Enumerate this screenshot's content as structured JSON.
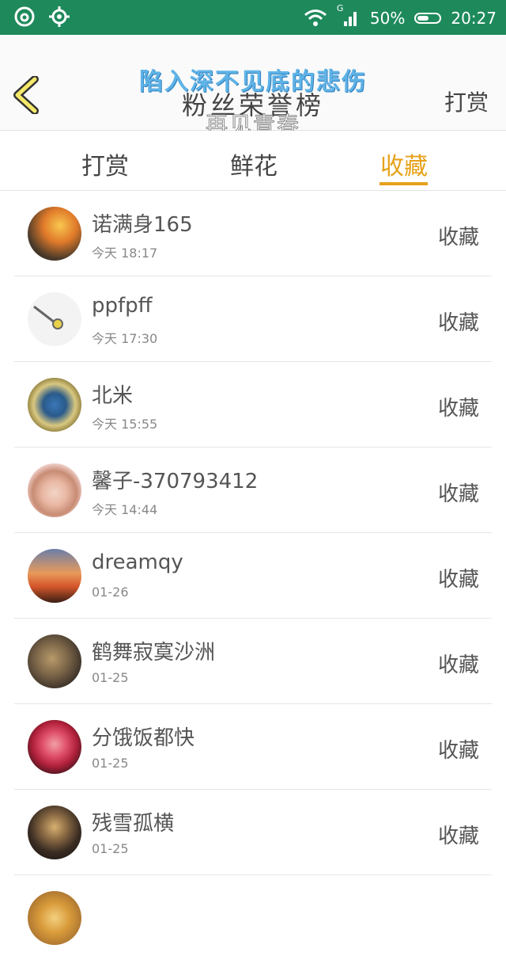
{
  "status_bar": {
    "signal_label": "G",
    "battery_percent": "50%",
    "time": "20:27"
  },
  "header": {
    "title": "粉丝荣誉榜",
    "overlay_top": "陷入深不见底的悲伤",
    "overlay_bottom": "再见青春",
    "action_label": "打赏"
  },
  "tabs": [
    {
      "label": "打赏",
      "active": false
    },
    {
      "label": "鲜花",
      "active": false
    },
    {
      "label": "收藏",
      "active": true
    }
  ],
  "list": [
    {
      "name": "诺满身165",
      "time": "今天 18:17",
      "action": "收藏"
    },
    {
      "name": "ppfpff",
      "time": "今天 17:30",
      "action": "收藏"
    },
    {
      "name": "北米",
      "time": "今天 15:55",
      "action": "收藏"
    },
    {
      "name": "馨子-370793412",
      "time": "今天 14:44",
      "action": "收藏"
    },
    {
      "name": "dreamqy",
      "time": "01-26",
      "action": "收藏"
    },
    {
      "name": "鹤舞寂寞沙洲",
      "time": "01-25",
      "action": "收藏"
    },
    {
      "name": "分饿饭都快",
      "time": "01-25",
      "action": "收藏"
    },
    {
      "name": "残雪孤横",
      "time": "01-25",
      "action": "收藏"
    }
  ],
  "colors": {
    "status_bar": "#1e8a5c",
    "accent": "#e6a21b",
    "back_arrow_fill": "#f5e96a",
    "back_arrow_stroke": "#333333"
  }
}
